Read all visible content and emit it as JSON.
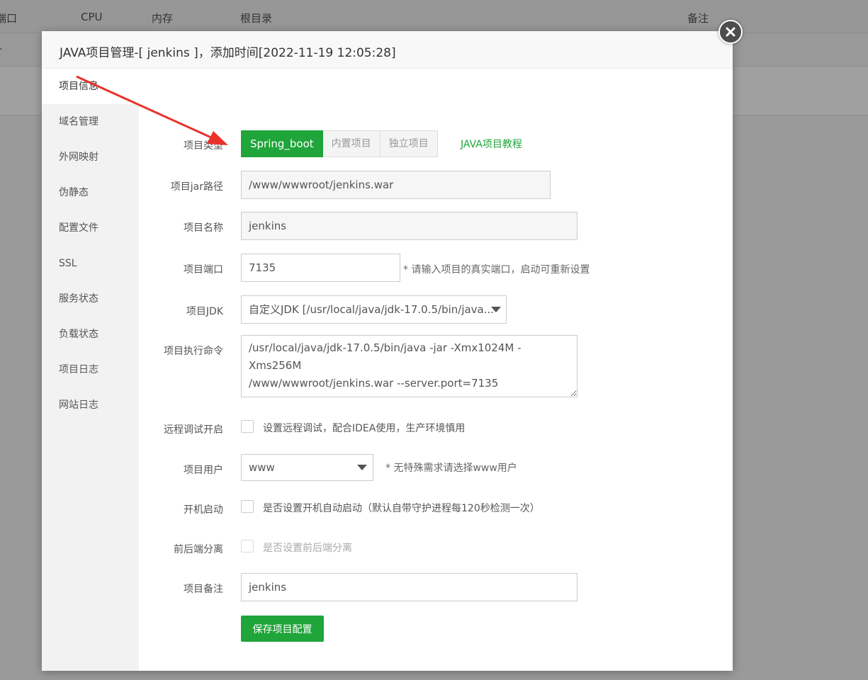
{
  "background": {
    "columns": {
      "port": "端口",
      "cpu": "CPU",
      "memory": "内存",
      "root": "根目录",
      "note": "备注"
    },
    "row_text": "-"
  },
  "modal": {
    "title": "JAVA项目管理-[ jenkins ]，添加时间[2022-11-19 12:05:28]",
    "close_icon": "close-icon"
  },
  "sidebar": {
    "items": [
      {
        "label": "项目信息",
        "active": true
      },
      {
        "label": "域名管理"
      },
      {
        "label": "外网映射"
      },
      {
        "label": "伪静态"
      },
      {
        "label": "配置文件"
      },
      {
        "label": "SSL"
      },
      {
        "label": "服务状态"
      },
      {
        "label": "负载状态"
      },
      {
        "label": "项目日志"
      },
      {
        "label": "网站日志"
      }
    ]
  },
  "form": {
    "project_type": {
      "label": "项目类型",
      "options": [
        "Spring_boot",
        "内置项目",
        "独立项目"
      ],
      "selected": "Spring_boot",
      "tutorial_link": "JAVA项目教程"
    },
    "jar_path": {
      "label": "项目jar路径",
      "value": "/www/wwwroot/jenkins.war"
    },
    "project_name": {
      "label": "项目名称",
      "value": "jenkins"
    },
    "project_port": {
      "label": "项目端口",
      "value": "7135",
      "hint": "* 请输入项目的真实端口，启动可重新设置"
    },
    "project_jdk": {
      "label": "项目JDK",
      "value": "自定义JDK [/usr/local/java/jdk-17.0.5/bin/java..."
    },
    "exec_command": {
      "label": "项目执行命令",
      "value": "/usr/local/java/jdk-17.0.5/bin/java -jar -Xmx1024M -Xms256M\n/www/wwwroot/jenkins.war --server.port=7135"
    },
    "remote_debug": {
      "label": "远程调试开启",
      "text": "设置远程调试，配合IDEA使用，生产环境慎用",
      "checked": false
    },
    "project_user": {
      "label": "项目用户",
      "value": "www",
      "hint": "* 无特殊需求请选择www用户"
    },
    "auto_start": {
      "label": "开机启动",
      "text": "是否设置开机自动启动（默认自带守护进程每120秒检测一次）",
      "checked": false
    },
    "frontend_separation": {
      "label": "前后端分离",
      "text": "是否设置前后端分离",
      "checked": false,
      "disabled": true
    },
    "project_note": {
      "label": "项目备注",
      "value": "jenkins"
    },
    "save_label": "保存项目配置"
  },
  "colors": {
    "accent": "#20a53a",
    "annotation_arrow": "#e8322b",
    "close_button": "#4d4d4d"
  }
}
